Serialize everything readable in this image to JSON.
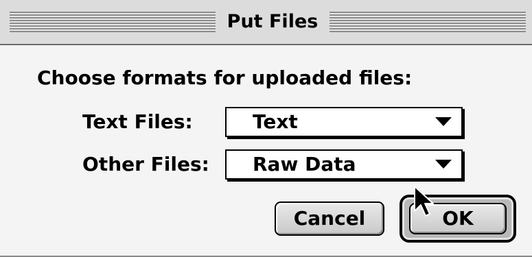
{
  "dialog": {
    "title": "Put Files",
    "prompt": "Choose formats for uploaded files:",
    "text_files": {
      "label": "Text Files:",
      "selected": "Text"
    },
    "other_files": {
      "label": "Other Files:",
      "selected": "Raw Data"
    },
    "buttons": {
      "cancel": "Cancel",
      "ok": "OK"
    },
    "default_button": "ok"
  }
}
